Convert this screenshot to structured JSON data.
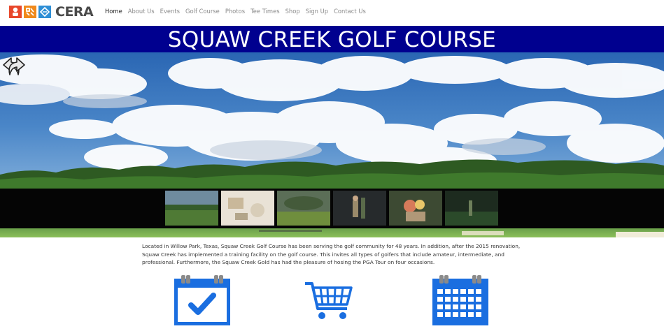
{
  "brand": {
    "name": "CERA"
  },
  "nav": {
    "items": [
      {
        "label": "Home",
        "active": true
      },
      {
        "label": "About Us",
        "active": false
      },
      {
        "label": "Events",
        "active": false
      },
      {
        "label": "Golf Course",
        "active": false
      },
      {
        "label": "Photos",
        "active": false
      },
      {
        "label": "Tee Times",
        "active": false
      },
      {
        "label": "Shop",
        "active": false
      },
      {
        "label": "Sign Up",
        "active": false
      },
      {
        "label": "Contact Us",
        "active": false
      }
    ]
  },
  "hero": {
    "title": "SQUAW CREEK GOLF COURSE",
    "thumbnail_count": 6
  },
  "intro": {
    "text": "Located in Willow Park, Texas, Squaw Creek Golf Course has been serving the golf community for 48 years. In addition, after the 2015 renovation, Squaw Creek has implemented a training facility on the golf course. This invites all types of golfers that include amateur, intermediate, and professional. Furthermore, the Squaw Creek Gold has had the pleasure of hosing the PGA Tour on four occasions."
  },
  "features": [
    {
      "icon": "calendar-check-icon"
    },
    {
      "icon": "shopping-cart-icon"
    },
    {
      "icon": "calendar-icon"
    }
  ],
  "colors": {
    "title_band": "#00008f",
    "icon_blue": "#1a6ee0",
    "nav_text": "#8a8a8a",
    "nav_active": "#222222"
  }
}
